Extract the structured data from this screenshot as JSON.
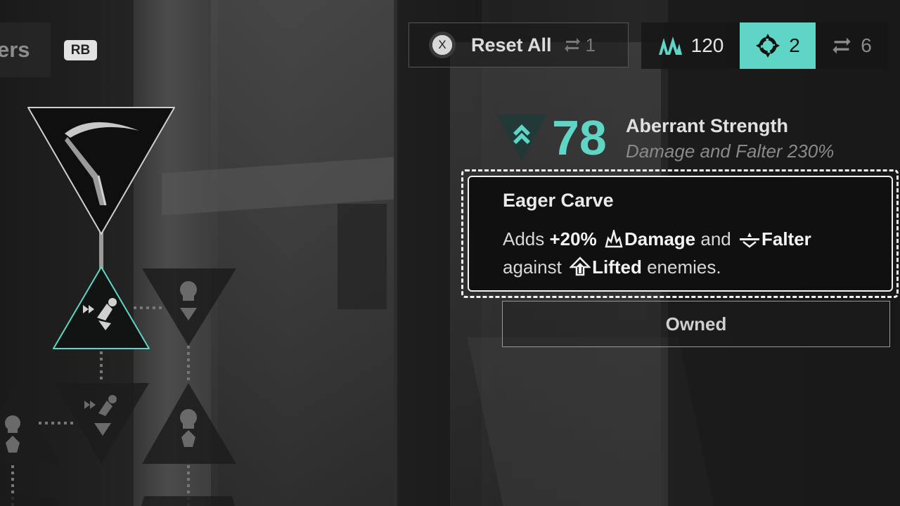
{
  "top_bar": {
    "tab_fragment": "ers",
    "rb_label": "RB",
    "reset_button_key": "X",
    "reset_label": "Reset All",
    "reset_cost": "1",
    "currencies": [
      {
        "icon": "spire-icon",
        "value": "120"
      },
      {
        "icon": "gear-ring-icon",
        "value": "2"
      },
      {
        "icon": "respec-icon",
        "value": "6"
      }
    ]
  },
  "stat": {
    "value": "78",
    "name": "Aberrant Strength",
    "description": "Damage and Falter 230%"
  },
  "card": {
    "title": "Eager Carve",
    "desc_adds": "Adds",
    "desc_amount": "+20%",
    "desc_damage": "Damage",
    "desc_and": "and",
    "desc_falter": "Falter",
    "desc_against": "against",
    "desc_lifted": "Lifted",
    "desc_enemies": "enemies.",
    "status": "Owned"
  },
  "colors": {
    "accent": "#5fd6c5",
    "card_bg": "#101010",
    "text": "#e8e8e8"
  }
}
